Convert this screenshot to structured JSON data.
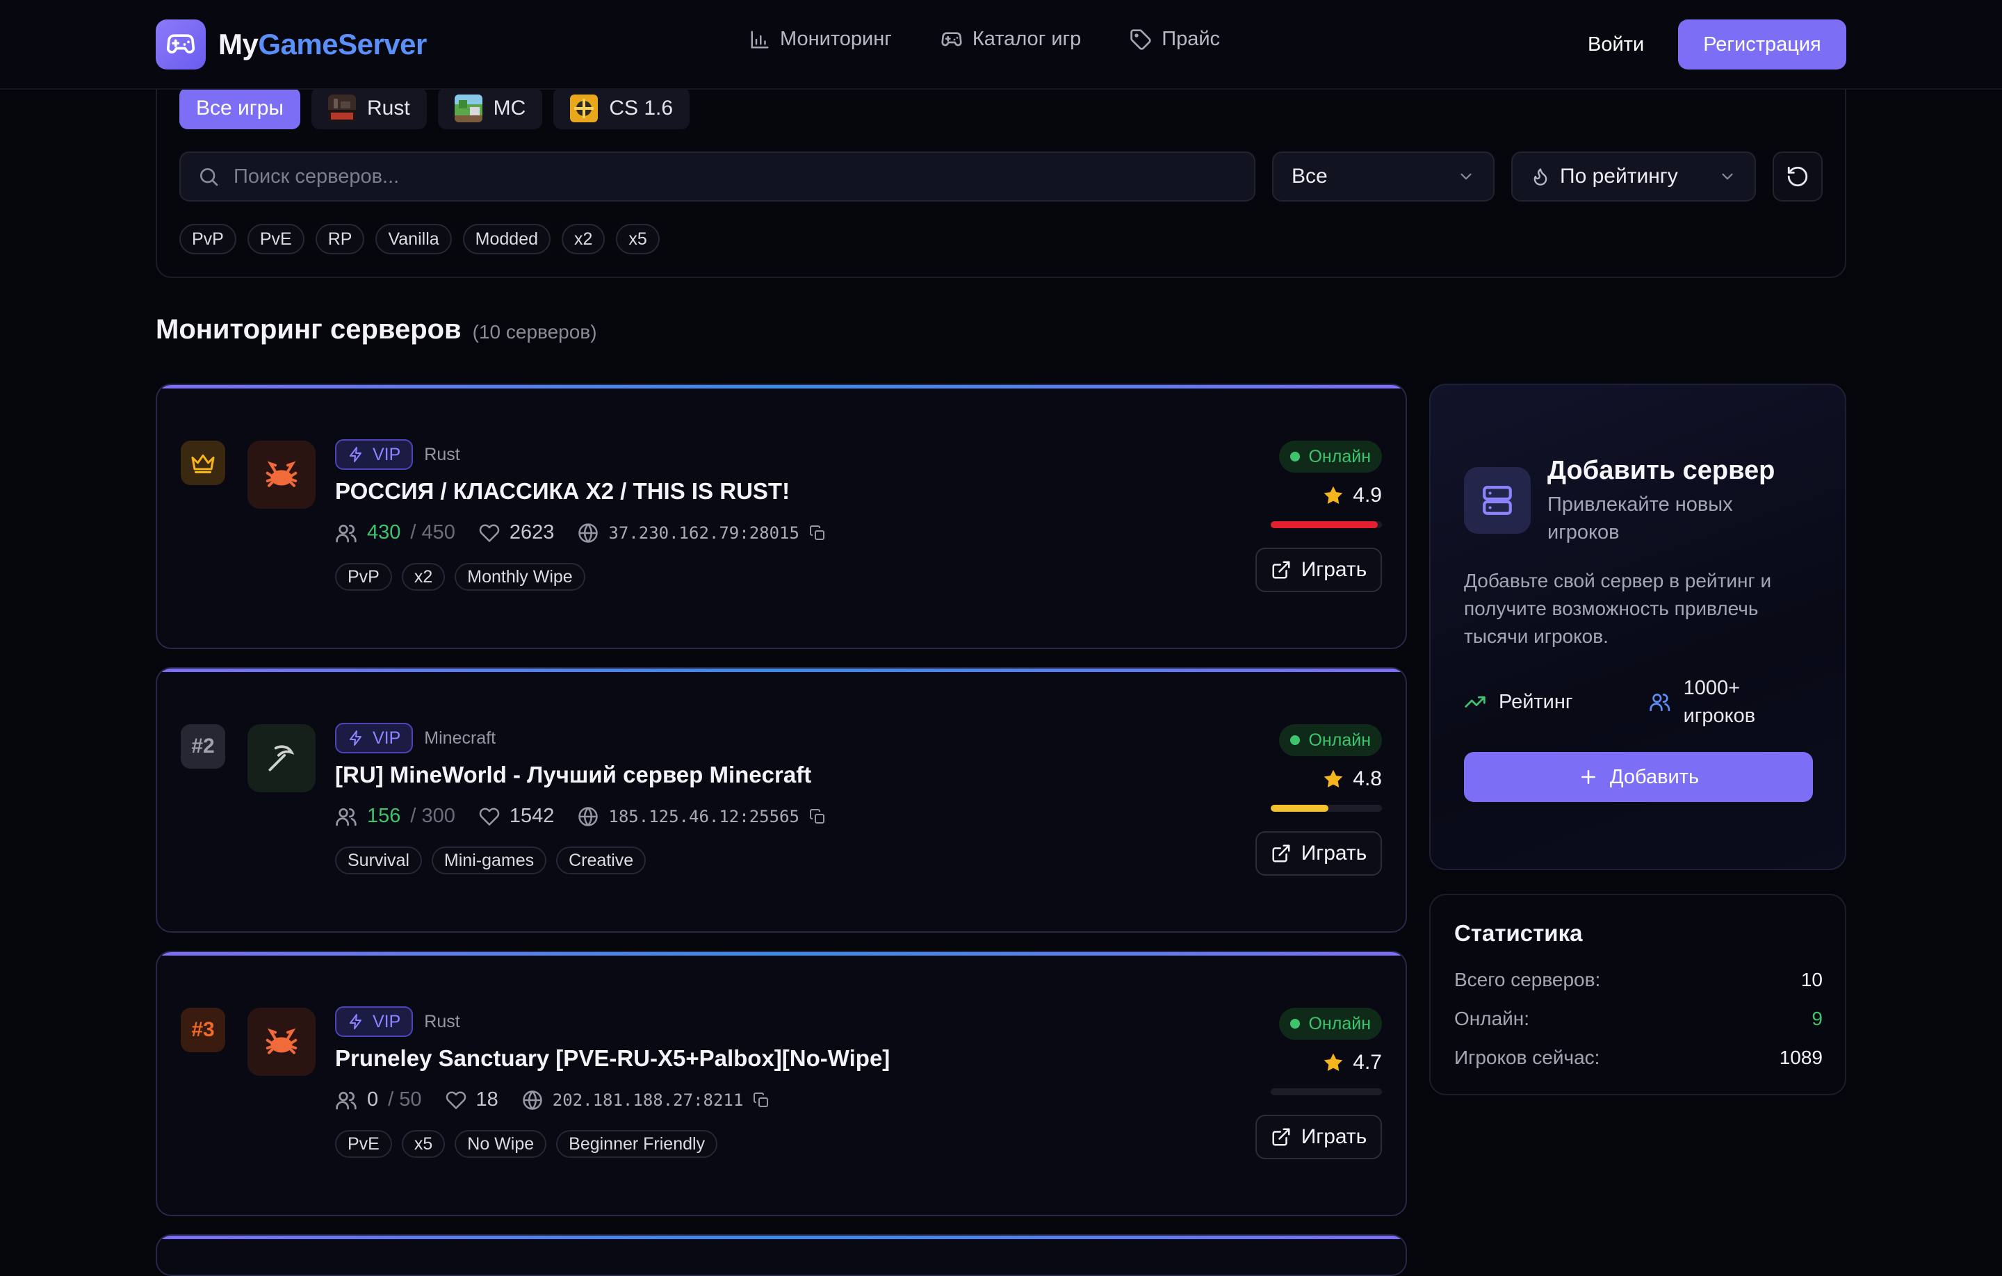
{
  "header": {
    "logo_part1": "My",
    "logo_part2": "GameServer",
    "nav": [
      {
        "label": "Мониторинг",
        "icon": "bar-chart-icon"
      },
      {
        "label": "Каталог игр",
        "icon": "gamepad-icon"
      },
      {
        "label": "Прайс",
        "icon": "tag-icon"
      }
    ],
    "login_label": "Войти",
    "register_label": "Регистрация"
  },
  "filters": {
    "game_tabs": [
      {
        "label": "Все игры",
        "active": true
      },
      {
        "label": "Rust",
        "active": false
      },
      {
        "label": "MC",
        "active": false
      },
      {
        "label": "CS 1.6",
        "active": false
      }
    ],
    "search_placeholder": "Поиск серверов...",
    "type_select": "Все",
    "sort_select": "По рейтингу",
    "tags": [
      "PvP",
      "PvE",
      "RP",
      "Vanilla",
      "Modded",
      "x2",
      "x5"
    ]
  },
  "section": {
    "title": "Мониторинг серверов",
    "count": "(10 серверов)"
  },
  "servers": [
    {
      "rank": "",
      "vip": "VIP",
      "game": "Rust",
      "name": "РОССИЯ / КЛАССИКА X2 / THIS IS RUST!",
      "players_online": "430",
      "players_max": "/ 450",
      "likes": "2623",
      "ip": "37.230.162.79:28015",
      "tags": [
        "PvP",
        "x2",
        "Monthly Wipe"
      ],
      "status": "Онлайн",
      "rating": "4.9",
      "load_fraction": 0.96,
      "load_color": "#e5202e",
      "play_label": "Играть"
    },
    {
      "rank": "#2",
      "vip": "VIP",
      "game": "Minecraft",
      "name": "[RU] MineWorld - Лучший сервер Minecraft",
      "players_online": "156",
      "players_max": "/ 300",
      "likes": "1542",
      "ip": "185.125.46.12:25565",
      "tags": [
        "Survival",
        "Mini-games",
        "Creative"
      ],
      "status": "Онлайн",
      "rating": "4.8",
      "load_fraction": 0.52,
      "load_color": "#f2c230",
      "play_label": "Играть"
    },
    {
      "rank": "#3",
      "vip": "VIP",
      "game": "Rust",
      "name": "Pruneley Sanctuary [PVE-RU-X5+Palbox][No-Wipe]",
      "players_online": "0",
      "players_max": "/ 50",
      "likes": "18",
      "ip": "202.181.188.27:8211",
      "tags": [
        "PvE",
        "x5",
        "No Wipe",
        "Beginner Friendly"
      ],
      "status": "Онлайн",
      "rating": "4.7",
      "load_fraction": 0,
      "load_color": "#3ec46d",
      "play_label": "Играть"
    }
  ],
  "add_server": {
    "title": "Добавить сервер",
    "subtitle": "Привлекайте новых игроков",
    "description": "Добавьте свой сервер в рейтинг и получите возможность привлечь тысячи игроков.",
    "feature_rating": "Рейтинг",
    "feature_players": "1000+ игроков",
    "button_label": "Добавить"
  },
  "stats": {
    "title": "Статистика",
    "rows": [
      {
        "label": "Всего серверов:",
        "value": "10"
      },
      {
        "label": "Онлайн:",
        "value": "9"
      },
      {
        "label": "Игроков сейчас:",
        "value": "1089"
      }
    ]
  },
  "colors": {
    "accent": "#7c6ff6",
    "brand_blue": "#5b8ff9",
    "online_green": "#3ec46d",
    "star": "#f5b51b"
  }
}
